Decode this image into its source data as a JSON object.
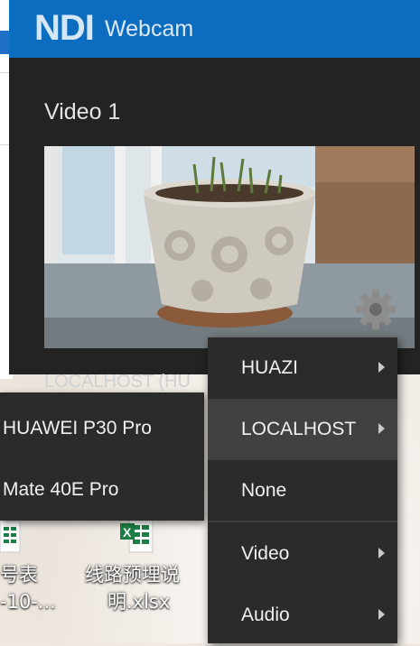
{
  "window": {
    "logo_text": "NDI",
    "title": "Webcam",
    "video_label": "Video 1",
    "source_label": "LOCALHOST (HU"
  },
  "main_menu": {
    "items": [
      {
        "label": "HUAZI",
        "has_submenu": true,
        "active": false
      },
      {
        "label": "LOCALHOST",
        "has_submenu": true,
        "active": true
      },
      {
        "label": "None",
        "has_submenu": false,
        "active": false
      },
      {
        "label": "Video",
        "has_submenu": true,
        "active": false
      },
      {
        "label": "Audio",
        "has_submenu": true,
        "active": false
      }
    ]
  },
  "sub_menu": {
    "items": [
      {
        "label": "HUAWEI P30 Pro"
      },
      {
        "label": "Mate 40E Pro"
      }
    ]
  },
  "desktop": {
    "files": [
      {
        "line1": "号表",
        "line2": "-10-..."
      },
      {
        "line1": "线路预埋说",
        "line2": "明.xlsx"
      }
    ]
  },
  "colors": {
    "titlebar": "#0b6cc0",
    "window_bg": "#232323",
    "menu_bg": "#2b2b2b",
    "menu_active": "#414141",
    "excel_green": "#1d7f45"
  },
  "icons": [
    "gear-icon",
    "excel-icon",
    "submenu-arrow-icon"
  ]
}
